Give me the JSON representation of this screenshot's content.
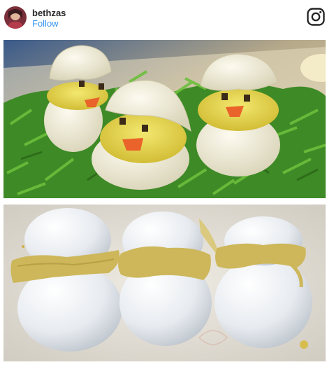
{
  "header": {
    "username": "bethzas",
    "follow_label": "Follow"
  },
  "icons": {
    "avatar": "profile-avatar",
    "brand": "instagram-icon"
  },
  "photos": [
    {
      "name": "chick-deviled-eggs-expectation"
    },
    {
      "name": "deviled-eggs-result"
    }
  ],
  "colors": {
    "link": "#3897f0",
    "text": "#262626",
    "yolk": "#e8d24a",
    "greens": "#3e8a26"
  }
}
